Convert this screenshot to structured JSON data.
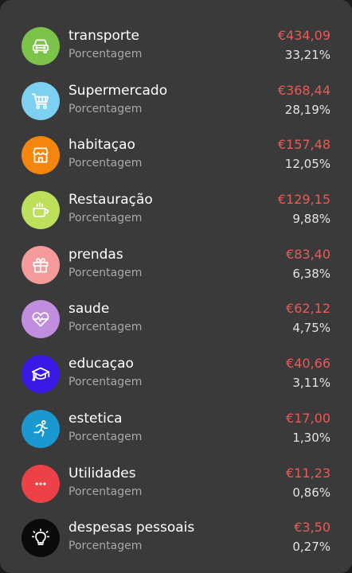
{
  "categories": [
    {
      "name": "transporte",
      "subtitle": "Porcentagem",
      "amount": "€434,09",
      "percent": "33,21%",
      "color": "#7cc34a",
      "icon": "car-icon"
    },
    {
      "name": "Supermercado",
      "subtitle": "Porcentagem",
      "amount": "€368,44",
      "percent": "28,19%",
      "color": "#7dd0f0",
      "icon": "shopping-cart-icon"
    },
    {
      "name": "habitaçao",
      "subtitle": "Porcentagem",
      "amount": "€157,48",
      "percent": "12,05%",
      "color": "#f5860d",
      "icon": "store-icon"
    },
    {
      "name": "Restauração",
      "subtitle": "Porcentagem",
      "amount": "€129,15",
      "percent": "9,88%",
      "color": "#bce05c",
      "icon": "coffee-cup-icon"
    },
    {
      "name": "prendas",
      "subtitle": "Porcentagem",
      "amount": "€83,40",
      "percent": "6,38%",
      "color": "#f59b9b",
      "icon": "gift-icon"
    },
    {
      "name": "saude",
      "subtitle": "Porcentagem",
      "amount": "€62,12",
      "percent": "4,75%",
      "color": "#c08ddf",
      "icon": "heart-pulse-icon"
    },
    {
      "name": "educaçao",
      "subtitle": "Porcentagem",
      "amount": "€40,66",
      "percent": "3,11%",
      "color": "#3a18e6",
      "icon": "graduation-cap-icon"
    },
    {
      "name": "estetica",
      "subtitle": "Porcentagem",
      "amount": "€17,00",
      "percent": "1,30%",
      "color": "#1b98cf",
      "icon": "running-person-icon"
    },
    {
      "name": "Utilidades",
      "subtitle": "Porcentagem",
      "amount": "€11,23",
      "percent": "0,86%",
      "color": "#ec4147",
      "icon": "more-dots-icon"
    },
    {
      "name": "despesas pessoais",
      "subtitle": "Porcentagem",
      "amount": "€3,50",
      "percent": "0,27%",
      "color": "#0a0a0a",
      "icon": "lightbulb-icon"
    }
  ]
}
